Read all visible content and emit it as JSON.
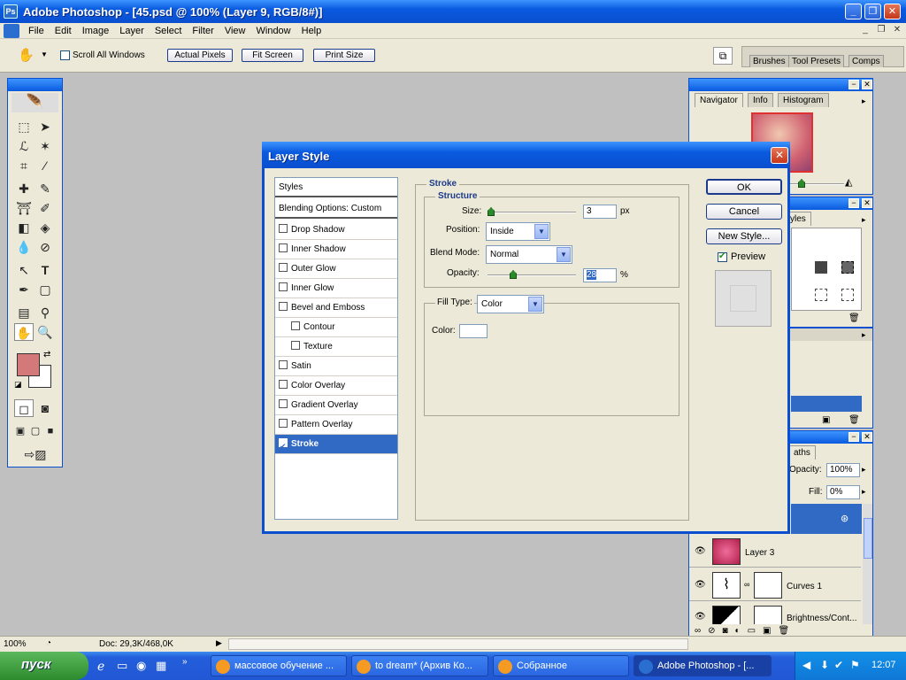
{
  "window": {
    "title": "Adobe Photoshop - [45.psd @ 100% (Layer 9, RGB/8#)]",
    "logo_text": "Ps"
  },
  "menu": [
    "File",
    "Edit",
    "Image",
    "Layer",
    "Select",
    "Filter",
    "View",
    "Window",
    "Help"
  ],
  "options_bar": {
    "scroll_all_windows": "Scroll All Windows",
    "actual_pixels": "Actual Pixels",
    "fit_screen": "Fit Screen",
    "print_size": "Print Size"
  },
  "palette_well": {
    "tabs": [
      "Brushes",
      "Tool Presets",
      "Comps"
    ]
  },
  "navigator": {
    "tabs": [
      "Navigator",
      "Info",
      "Histogram"
    ]
  },
  "styles_palette": {
    "tab": "yles"
  },
  "layers_palette": {
    "tab": "aths",
    "opacity_label": "Opacity:",
    "opacity_value": "100%",
    "fill_label": "Fill:",
    "fill_value": "0%",
    "layers": [
      {
        "name": "Layer 3"
      },
      {
        "name": "Curves 1"
      },
      {
        "name": "Brightness/Cont..."
      }
    ]
  },
  "dialog": {
    "title": "Layer Style",
    "style_list": {
      "styles": "Styles",
      "blending": "Blending Options: Custom",
      "items": [
        {
          "label": "Drop Shadow",
          "checked": false,
          "indent": false
        },
        {
          "label": "Inner Shadow",
          "checked": false,
          "indent": false
        },
        {
          "label": "Outer Glow",
          "checked": false,
          "indent": false
        },
        {
          "label": "Inner Glow",
          "checked": false,
          "indent": false
        },
        {
          "label": "Bevel and Emboss",
          "checked": false,
          "indent": false
        },
        {
          "label": "Contour",
          "checked": false,
          "indent": true
        },
        {
          "label": "Texture",
          "checked": false,
          "indent": true
        },
        {
          "label": "Satin",
          "checked": false,
          "indent": false
        },
        {
          "label": "Color Overlay",
          "checked": false,
          "indent": false
        },
        {
          "label": "Gradient Overlay",
          "checked": false,
          "indent": false
        },
        {
          "label": "Pattern Overlay",
          "checked": false,
          "indent": false
        },
        {
          "label": "Stroke",
          "checked": true,
          "indent": false,
          "selected": true
        }
      ]
    },
    "stroke": {
      "heading": "Stroke",
      "structure": "Structure",
      "size_label": "Size:",
      "size_value": "3",
      "size_unit": "px",
      "position_label": "Position:",
      "position_value": "Inside",
      "blend_label": "Blend Mode:",
      "blend_value": "Normal",
      "opacity_label": "Opacity:",
      "opacity_value": "28",
      "opacity_unit": "%",
      "fill_type_label": "Fill Type:",
      "fill_type_value": "Color",
      "color_label": "Color:",
      "color_value": "#ffffff"
    },
    "buttons": {
      "ok": "OK",
      "cancel": "Cancel",
      "new_style": "New Style...",
      "preview": "Preview"
    }
  },
  "status": {
    "zoom": "100%",
    "doc": "Doc: 29,3K/468,0K"
  },
  "taskbar": {
    "start": "пуск",
    "items": [
      {
        "label": "массовое обучение ...",
        "active": false
      },
      {
        "label": "to dream* (Архив Ко...",
        "active": false
      },
      {
        "label": "Собранное",
        "active": false
      },
      {
        "label": "Adobe Photoshop - [...",
        "active": true
      }
    ],
    "clock": "12:07"
  },
  "colors": {
    "foreground": "#d4797a",
    "background": "#ffffff",
    "selection": "#316ac5"
  }
}
